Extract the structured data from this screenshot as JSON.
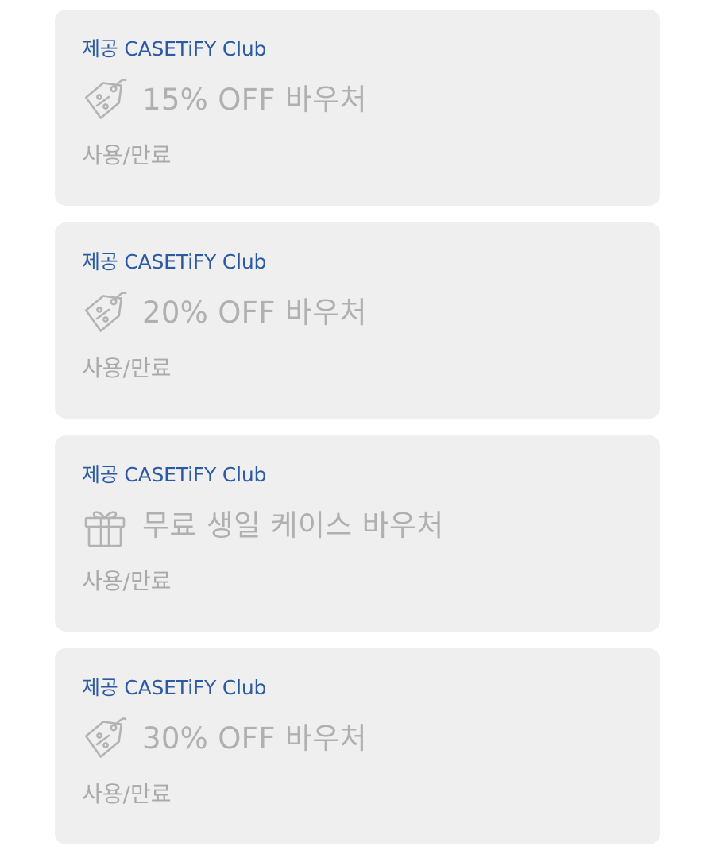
{
  "vouchers": [
    {
      "provider": "제공 CASETiFY Club",
      "icon": "discount-tag-icon",
      "title": "15% OFF 바우처",
      "status": "사용/만료"
    },
    {
      "provider": "제공 CASETiFY Club",
      "icon": "discount-tag-icon",
      "title": "20% OFF 바우처",
      "status": "사용/만료"
    },
    {
      "provider": "제공 CASETiFY Club",
      "icon": "gift-icon",
      "title": "무료 생일 케이스 바우처",
      "status": "사용/만료"
    },
    {
      "provider": "제공 CASETiFY Club",
      "icon": "discount-tag-icon",
      "title": "30% OFF 바우처",
      "status": "사용/만료"
    }
  ],
  "colors": {
    "card_background": "#efefef",
    "provider_text": "#2b5aa3",
    "muted_text": "#b0b0b0"
  }
}
